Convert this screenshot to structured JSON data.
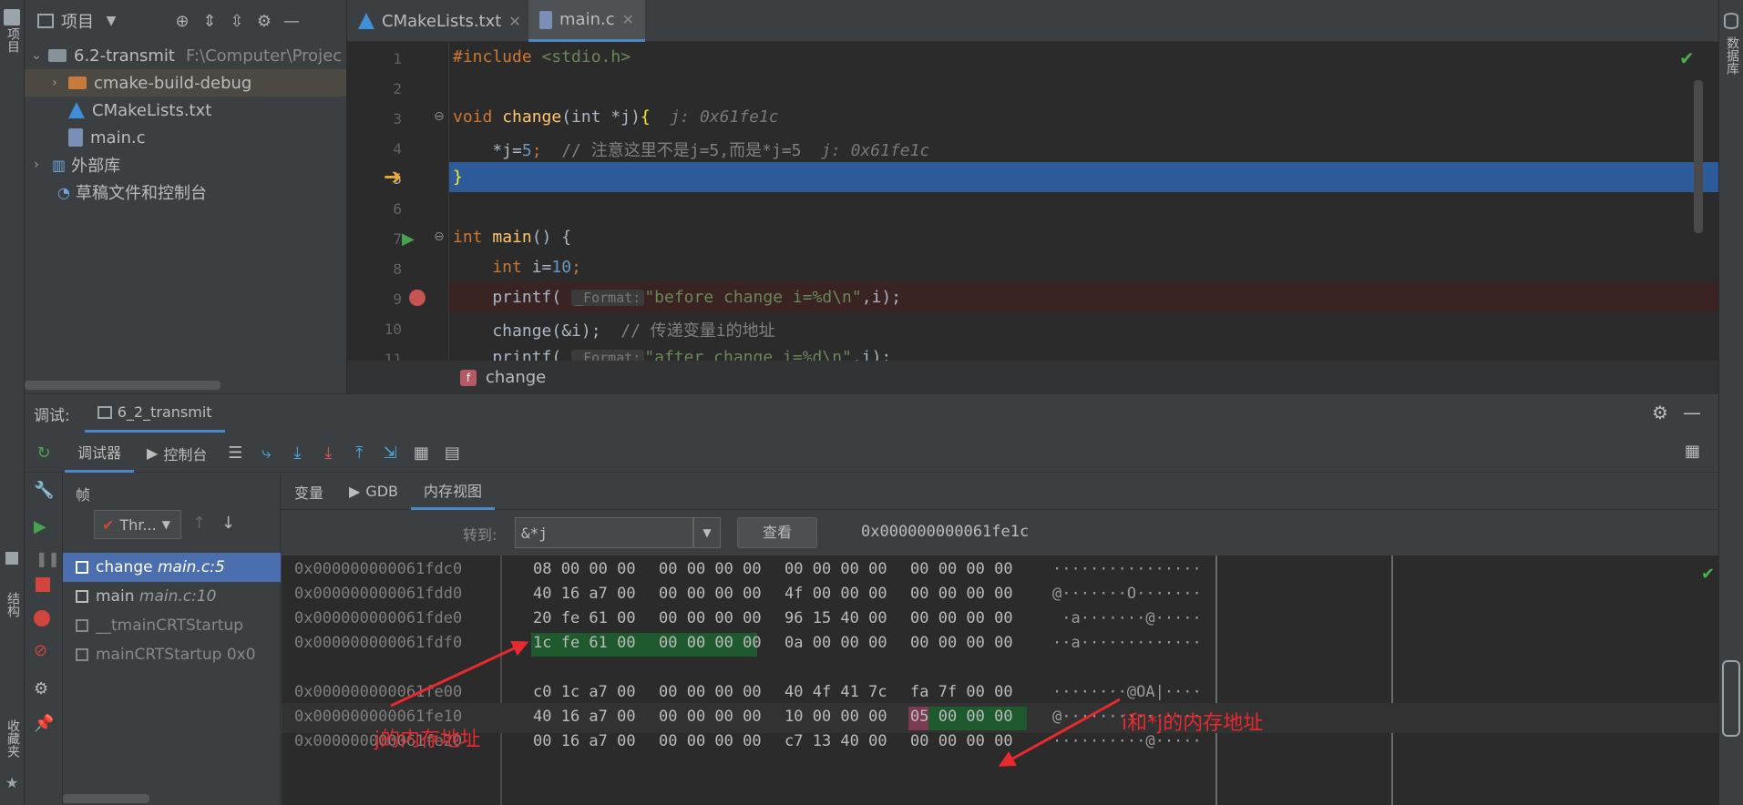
{
  "left_strip": {
    "label_top": "项目",
    "label_mid": "结构",
    "label_bottom": "收藏夹"
  },
  "right_strip": {
    "label": "数据库"
  },
  "project": {
    "title": "项目",
    "tree": [
      {
        "label": "6.2-transmit",
        "path": "F:\\Computer\\Projec",
        "type": "folder"
      },
      {
        "label": "cmake-build-debug",
        "type": "folder-orange"
      },
      {
        "label": "CMakeLists.txt",
        "type": "cmake"
      },
      {
        "label": "main.c",
        "type": "c"
      },
      {
        "label": "外部库",
        "type": "lib"
      },
      {
        "label": "草稿文件和控制台",
        "type": "scratch"
      }
    ]
  },
  "editor": {
    "tabs": [
      "CMakeLists.txt",
      "main.c"
    ],
    "line_numbers": [
      "1",
      "2",
      "3",
      "4",
      "5",
      "6",
      "7",
      "8",
      "9",
      "10",
      "11"
    ],
    "breadcrumb": "change",
    "lines": {
      "l1_kw": "#include",
      "l1_str": " <stdio.h>",
      "l3_kw": "void",
      "l3_fn": " change",
      "l3_rest": "(int *j)",
      "l3_brace": "{",
      "l3_inline": "  j: 0x61fe1c",
      "l4_code": "    *j=",
      "l4_num": "5",
      "l4_semi": ";",
      "l4_cmt": "  // 注意这里不是j=5,而是*j=5",
      "l4_inline": "  j: 0x61fe1c",
      "l5_brace": "}",
      "l7_kw": "int",
      "l7_fn": " main",
      "l7_rest": "() {",
      "l8_kw": "    int",
      "l8_rest": " i=",
      "l8_num": "10",
      "l8_semi": ";",
      "l9_code": "    printf(",
      "l9_hint": "_Format:",
      "l9_str": "\"before change i=%d\\n\"",
      "l9_rest": ",i);",
      "l10_code": "    change(&i);",
      "l10_cmt": "  // 传递变量i的地址",
      "l11_code": "    printf(",
      "l11_hint": "_Format:",
      "l11_str": "\"after change i=%d\\n\"",
      "l11_rest": ",i);"
    }
  },
  "debug": {
    "label": "调试:",
    "config": "6_2_transmit",
    "tabs": {
      "debugger": "调试器",
      "console": "控制台"
    },
    "frames_label": "帧",
    "thread_select": "Thr...",
    "frames": [
      {
        "fn": "change",
        "loc": "main.c:5"
      },
      {
        "fn": "main",
        "loc": "main.c:10"
      },
      {
        "fn": "__tmainCRTStartup",
        "loc": ""
      },
      {
        "fn": "mainCRTStartup",
        "loc": "0x0"
      }
    ],
    "mem_tabs": {
      "variables": "变量",
      "gdb": "GDB",
      "memory": "内存视图"
    },
    "goto_label": "转到:",
    "goto_value": "&*j",
    "view_button": "查看",
    "resolved_address": "0x000000000061fe1c",
    "memory_rows": [
      {
        "addr": "0x000000000061fdc0",
        "g1": "08 00 00 00",
        "g2": "00 00 00 00",
        "g3": "00 00 00 00",
        "g4": "00 00 00 00",
        "ascii": "················"
      },
      {
        "addr": "0x000000000061fdd0",
        "g1": "40 16 a7 00",
        "g2": "00 00 00 00",
        "g3": "4f 00 00 00",
        "g4": "00 00 00 00",
        "ascii": "@·······O·······"
      },
      {
        "addr": "0x000000000061fde0",
        "g1": "20 fe 61 00",
        "g2": "00 00 00 00",
        "g3": "96 15 40 00",
        "g4": "00 00 00 00",
        "ascii": " ·a·······@·····"
      },
      {
        "addr": "0x000000000061fdf0",
        "g1": "1c fe 61 00",
        "g2": "00 00 00 00",
        "g3": "0a 00 00 00",
        "g4": "00 00 00 00",
        "ascii": "··a·············"
      },
      {
        "addr": "0x000000000061fe00",
        "g1": "c0 1c a7 00",
        "g2": "00 00 00 00",
        "g3": "40 4f 41 7c",
        "g4": "fa 7f 00 00",
        "ascii": "········@OA|····"
      },
      {
        "addr": "0x000000000061fe10",
        "g1": "40 16 a7 00",
        "g2": "00 00 00 00",
        "g3": "10 00 00 00",
        "g4": "05 00 00 00",
        "ascii": "@···············"
      },
      {
        "addr": "0x000000000061fe20",
        "g1": "00 16 a7 00",
        "g2": "00 00 00 00",
        "g3": "c7 13 40 00",
        "g4": "00 00 00 00",
        "ascii": "··········@·····"
      }
    ],
    "annotations": {
      "j_addr": "j的内存地址",
      "i_addr": "i和*j的内存地址"
    }
  },
  "colors": {
    "selection": "#2d5b99",
    "breakpoint_line": "#3a2323",
    "highlight_green": "#1e5a2e",
    "annotation": "#e8292f"
  }
}
